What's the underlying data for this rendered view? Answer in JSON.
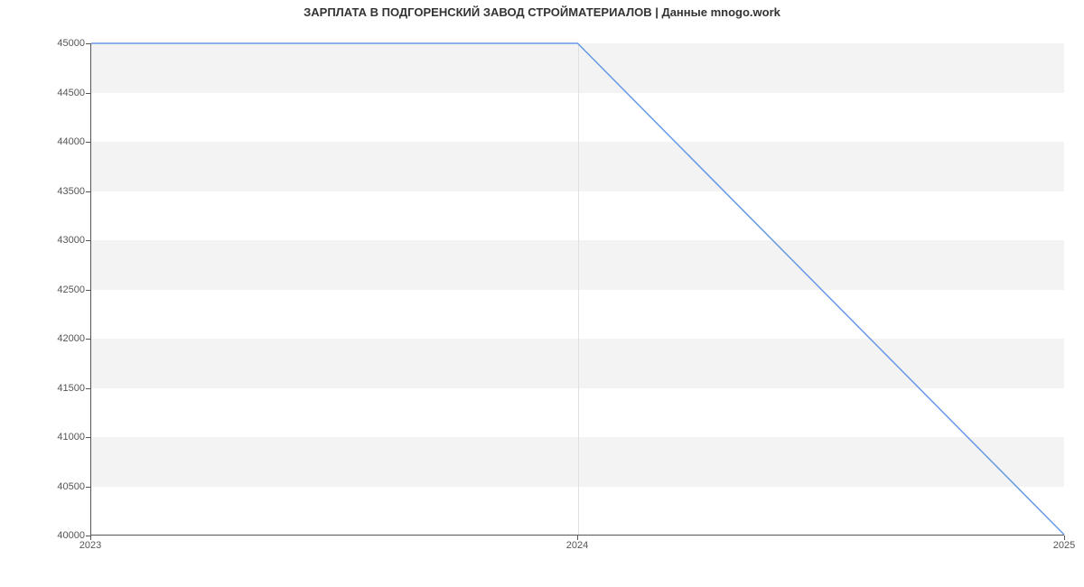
{
  "chart_data": {
    "type": "line",
    "title": "ЗАРПЛАТА В  ПОДГОРЕНСКИЙ ЗАВОД СТРОЙМАТЕРИАЛОВ | Данные mnogo.work",
    "xlabel": "",
    "ylabel": "",
    "x": [
      2023,
      2024,
      2025
    ],
    "values": [
      45000,
      45000,
      40000
    ],
    "x_ticks": [
      2023,
      2024,
      2025
    ],
    "y_ticks": [
      40000,
      40500,
      41000,
      41500,
      42000,
      42500,
      43000,
      43500,
      44000,
      44500,
      45000
    ],
    "ylim": [
      40000,
      45000
    ],
    "xlim": [
      2023,
      2025
    ],
    "line_color": "#6699e6",
    "band_color": "#f3f3f3",
    "grid": true
  }
}
